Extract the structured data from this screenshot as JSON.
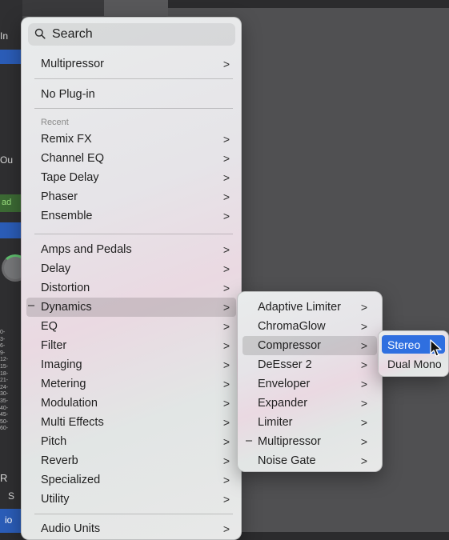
{
  "background_strip": {
    "labels": [
      "In",
      "Ou",
      "ad",
      "R",
      "S",
      "io"
    ],
    "meter_scale": [
      "0-",
      "3-",
      "6-",
      "9-",
      "12-",
      "15-",
      "18-",
      "21-",
      "24-",
      "30-",
      "35-",
      "40-",
      "45-",
      "50-",
      "60-"
    ]
  },
  "search": {
    "label": "Search"
  },
  "top_item": {
    "label": "Multipressor"
  },
  "no_plugin": {
    "label": "No Plug-in"
  },
  "recent": {
    "heading": "Recent",
    "items": [
      {
        "label": "Remix FX"
      },
      {
        "label": "Channel EQ"
      },
      {
        "label": "Tape Delay"
      },
      {
        "label": "Phaser"
      },
      {
        "label": "Ensemble"
      }
    ]
  },
  "categories": [
    {
      "label": "Amps and Pedals"
    },
    {
      "label": "Delay"
    },
    {
      "label": "Distortion"
    },
    {
      "label": "Dynamics",
      "active": true,
      "marker": "–"
    },
    {
      "label": "EQ"
    },
    {
      "label": "Filter"
    },
    {
      "label": "Imaging"
    },
    {
      "label": "Metering"
    },
    {
      "label": "Modulation"
    },
    {
      "label": "Multi Effects"
    },
    {
      "label": "Pitch"
    },
    {
      "label": "Reverb"
    },
    {
      "label": "Specialized"
    },
    {
      "label": "Utility"
    }
  ],
  "audio_units": {
    "label": "Audio Units"
  },
  "chevron": ">",
  "dynamics_submenu": [
    {
      "label": "Adaptive Limiter"
    },
    {
      "label": "ChromaGlow"
    },
    {
      "label": "Compressor",
      "active": true
    },
    {
      "label": "DeEsser 2"
    },
    {
      "label": "Enveloper"
    },
    {
      "label": "Expander"
    },
    {
      "label": "Limiter"
    },
    {
      "label": "Multipressor",
      "marker": "–"
    },
    {
      "label": "Noise Gate"
    }
  ],
  "compressor_submenu": [
    {
      "label": "Stereo",
      "selected": true
    },
    {
      "label": "Dual Mono"
    }
  ],
  "colors": {
    "selection": "#2f6fe0",
    "highlight": "rgba(0,0,0,0.13)"
  }
}
